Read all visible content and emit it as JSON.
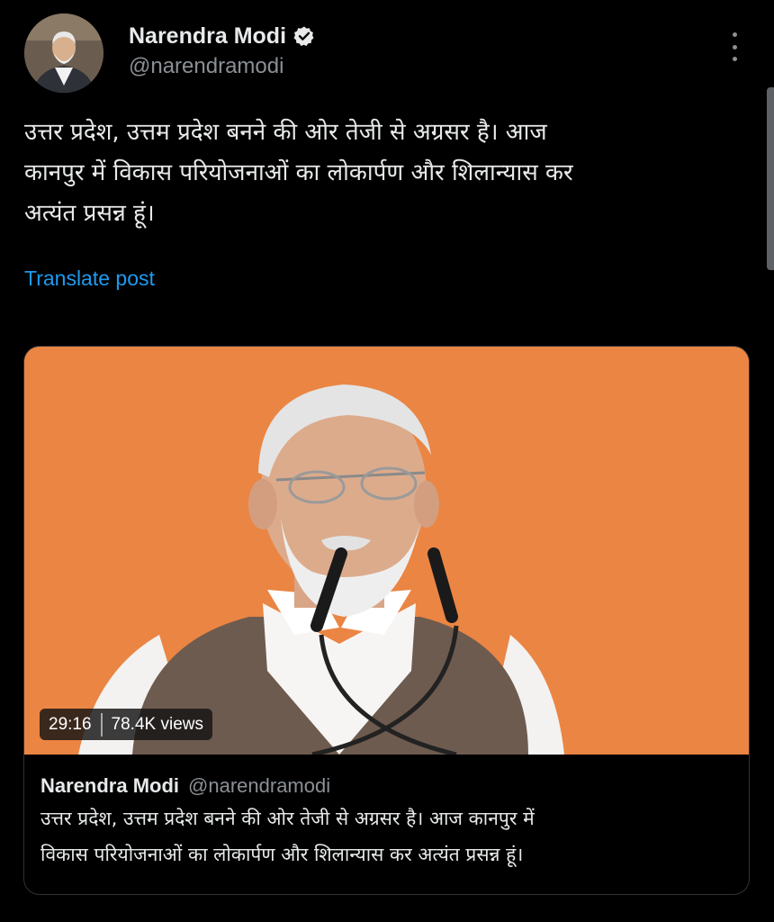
{
  "author": {
    "display_name": "Narendra Modi",
    "handle": "@narendramodi",
    "verified": true,
    "verified_badge_color": "#e7e9ea"
  },
  "post": {
    "text": "उत्तर प्रदेश, उत्तम प्रदेश बनने की ओर तेजी से अग्रसर है। आज\nकानपुर में विकास परियोजनाओं का लोकार्पण और शिलान्यास कर\nअत्यंत प्रसन्न हूं।",
    "translate_label": "Translate post"
  },
  "media": {
    "duration": "29:16",
    "views": "78.4K views"
  },
  "quoted": {
    "display_name": "Narendra Modi",
    "handle": "@narendramodi",
    "text": "उत्तर प्रदेश, उत्तम प्रदेश बनने की ओर तेजी से अग्रसर है। आज कानपुर में\nविकास परियोजनाओं का लोकार्पण और शिलान्यास कर अत्यंत प्रसन्न हूं।"
  },
  "icons": {
    "verified": "verified-badge-icon",
    "more": "more-options-icon"
  },
  "colors": {
    "background": "#000000",
    "text_primary": "#e7e9ea",
    "text_secondary": "#8b9095",
    "link": "#1d9bf0",
    "video_backdrop": "#e9823f"
  }
}
